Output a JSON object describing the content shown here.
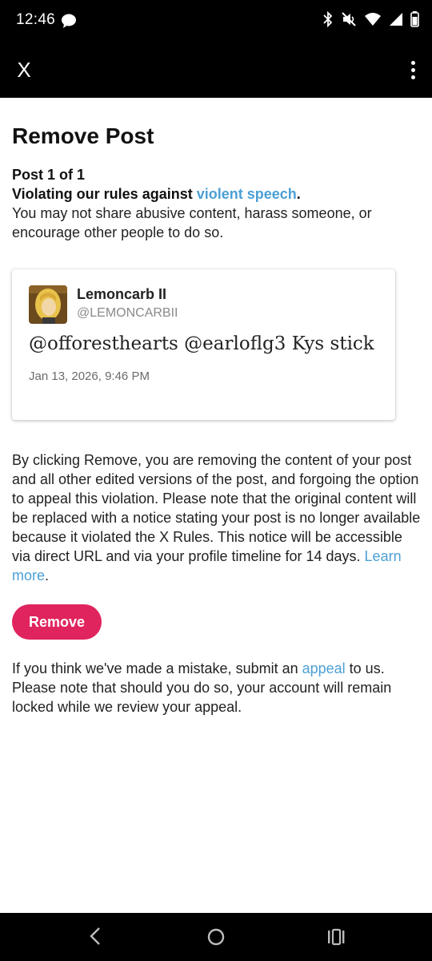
{
  "status_bar": {
    "time": "12:46"
  },
  "app_bar": {
    "close_label": "X"
  },
  "page": {
    "title": "Remove Post",
    "post_count": "Post 1 of 1",
    "rule_prefix": "Violating our rules against ",
    "rule_link": "violent speech",
    "rule_suffix": ".",
    "rule_description": "You may not share abusive content, harass someone, or encourage other people to do so."
  },
  "post": {
    "display_name": "Lemoncarb II",
    "handle": "@LEMONCARBII",
    "text": "@offoresthearts @earloflg3 Kys stick",
    "timestamp": "Jan 13, 2026, 9:46 PM"
  },
  "notice": {
    "text": "By clicking Remove, you are removing the content of your post and all other edited versions of the post, and forgoing the option to appeal this violation. Please note that the original content will be replaced with a notice stating your post is no longer available because it violated the X Rules. This notice will be accessible via direct URL and via your profile timeline for 14 days. ",
    "learn_more": "Learn more",
    "suffix": "."
  },
  "actions": {
    "remove_label": "Remove"
  },
  "appeal": {
    "prefix": "If you think we've made a mistake, submit an ",
    "link": "appeal",
    "suffix": " to us. Please note that should you do so, your account will remain locked while we review your appeal."
  },
  "colors": {
    "link": "#4b9fd5",
    "remove_button": "#e0245e"
  }
}
